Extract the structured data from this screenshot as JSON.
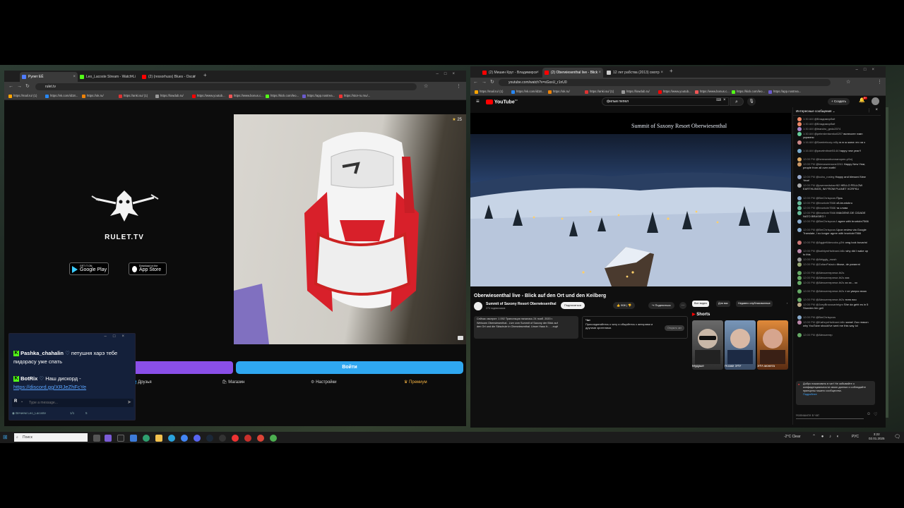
{
  "left_browser": {
    "tabs": [
      {
        "title": "Рулет ЕЁ",
        "color": "#4f7cff",
        "active": true
      },
      {
        "title": "Leo_Lacoste Stream - Watch Li",
        "color": "#53fc18",
        "active": false
      },
      {
        "title": "(2) (ressorhuss) Blues - Oscar",
        "color": "#ff0000",
        "active": false
      }
    ],
    "url": "rulet.tv",
    "bookmarks": [
      {
        "label": "https://mail.ru/ (1)",
        "color": "#ffa400"
      },
      {
        "label": "https://vk.com/id18...",
        "color": "#2787f5"
      },
      {
        "label": "https://ok.ru/",
        "color": "#ee8208"
      },
      {
        "label": "https://anki.su/ (1)",
        "color": "#d33"
      },
      {
        "label": "https://lowdub.ru/",
        "color": "#999"
      },
      {
        "label": "https://www.youtub...",
        "color": "#ff0000"
      },
      {
        "label": "https://www.bonus.c...",
        "color": "#e55"
      },
      {
        "label": "https://kick.com/leo...",
        "color": "#53fc18"
      },
      {
        "label": "https://app.nostrea...",
        "color": "#6a5acd"
      },
      {
        "label": "https://stor-ru.mu/...",
        "color": "#e33"
      }
    ],
    "site": {
      "logo_text": "RULET.TV",
      "google_play_top": "GET IT ON",
      "google_play": "Google Play",
      "app_store_top": "Download on the",
      "app_store": "App Store",
      "viewer_count": "25",
      "join_button": "Войти",
      "nav": [
        {
          "label": "Друзья",
          "icon": "friends-icon"
        },
        {
          "label": "Магазин",
          "icon": "shop-icon"
        },
        {
          "label": "Настройки",
          "icon": "gear-icon"
        },
        {
          "label": "Премиум",
          "icon": "crown-icon"
        }
      ]
    }
  },
  "chat_overlay": {
    "messages": [
      {
        "user": "Pashka_chahalin",
        "text": "петушня харэ тебе пидорасу уже спать"
      },
      {
        "user": "BotRix",
        "text": "Наш дискорд -"
      }
    ],
    "link": "https://discord.gg/XRJeZhFcYe",
    "input_placeholder": "Type a message...",
    "footer_user": "Вечием Leo_Lacoste",
    "footer_stats": "1/1",
    "footer_count": "5"
  },
  "right_browser": {
    "tabs": [
      {
        "title": "(2) Мишин Круг - Владимирск",
        "color": "#ff0000",
        "active": false
      },
      {
        "title": "(2) Oberwiesenthal live - Blick",
        "color": "#ff0000",
        "active": true
      },
      {
        "title": "12 лет рабства (2013) смотр",
        "color": "#cccccc",
        "active": false
      }
    ],
    "url": "youtube.com/watch?v=sGsxU_r1nU0",
    "bookmarks": [
      {
        "label": "https://mail.ru/ (1)",
        "color": "#ffa400"
      },
      {
        "label": "https://vk.com/id18...",
        "color": "#2787f5"
      },
      {
        "label": "https://ok.ru/",
        "color": "#ee8208"
      },
      {
        "label": "https://anki.su/ (1)",
        "color": "#d33"
      },
      {
        "label": "https://lowdub.ru/",
        "color": "#999"
      },
      {
        "label": "https://www.youtub...",
        "color": "#ff0000"
      },
      {
        "label": "https://www.bonus.c...",
        "color": "#e55"
      },
      {
        "label": "https://kick.com/leo...",
        "color": "#53fc18"
      },
      {
        "label": "https://app.nostrea...",
        "color": "#6a5acd"
      }
    ]
  },
  "youtube": {
    "logo": "YouTube",
    "country": "RU",
    "search_value": "фильм пепел",
    "create_button": "Создать",
    "notification_count": "9+",
    "video_overlay_title": "Summit of Saxony Resort Oberwiesenthal",
    "video_title": "Oberwiesenthal live - Blick auf den Ort und den Keilberg",
    "channel_name": "Summit of Saxony Resort Oberwiesenthal",
    "subscribers": "274 подписчиков",
    "subscribe_button": "Подписаться",
    "likes": "908",
    "share_button": "Поделиться",
    "description_line1": "Сейчас смотрят: 1 092  Трансляция началась 24 нояб. 2020 г.",
    "description_line2": "Webcam Oberwiesenthal - Live vom Summit of Saxony der Blick auf",
    "description_line3": "den Ort und die Skischule in Oberwiesenthal. Unser Haus fr...  ...ещё",
    "chat_join_label": "Чат",
    "chat_join_text": "Присоединяйтесь к чату и общайтесь с авторами и другими зрителями.",
    "chat_join_button": "Открыть чат",
    "filter_chips": [
      "Все видео",
      "Для вас",
      "Недавно опубликованные"
    ],
    "shorts_label": "Shorts",
    "shorts": [
      {
        "title": "Мудрые"
      },
      {
        "title": "Позже ЭТУ"
      },
      {
        "title": "ЭТА монета"
      }
    ],
    "chat": {
      "header": "Интересные сообщения",
      "input_placeholder": "Напишите в чат",
      "messages": [
        {
          "time": "1:30 AM",
          "user": "@Владимирбаё",
          "text": "",
          "color": "#e86"
        },
        {
          "time": "1:30 AM",
          "user": "@Владимирбаё",
          "text": "",
          "color": "#e86"
        },
        {
          "time": "1:30 AM",
          "user": "@leandro_gedo2074",
          "text": "",
          "color": "#a8c"
        },
        {
          "time": "1:30 AM",
          "user": "@peterdenisenko6207",
          "text": "включите гимн украины",
          "color": "#6c9"
        },
        {
          "time": "1:16 AM",
          "user": "@Samiretcury-m5y",
          "text": "ю ю ж жопа что за з",
          "color": "#c88"
        },
        {
          "time": "1:16 AM",
          "user": "@pavelmitroiri5144",
          "text": "happy new year!!",
          "color": "#7ac"
        },
        {
          "time": "12:00 PM",
          "user": "@hermannbonnanopen-yl1ej",
          "text": "",
          "color": "#da6"
        },
        {
          "time": "12:00 PM",
          "user": "@kievsweenone2241",
          "text": "Happy New Year, people from all over earth!",
          "color": "#c96"
        },
        {
          "time": "12:00 PM",
          "user": "@cubo_rosteg",
          "text": "Happy and blessed New Year!",
          "color": "#9ac"
        },
        {
          "time": "12:00 PM",
          "user": "@pwemedwlacrf82",
          "text": "HELLO FELLOW EARTHLINGS, IM FROM PLANET XCRFKU",
          "color": "#aaa"
        },
        {
          "time": "12:00 PM",
          "user": "@BmChrispcos",
          "text": "Пусь",
          "color": "#8ac"
        },
        {
          "time": "12:00 PM",
          "user": "@bruntobr7566",
          "text": "хй-bruntobru",
          "color": "#6b9"
        },
        {
          "time": "12:00 PM",
          "user": "@bruntobr7566",
          "text": "та слова",
          "color": "#6b9"
        },
        {
          "time": "12:00 PM",
          "user": "@bruntobr7566",
          "text": "IMAGENS DE CIDADE NATO BRASIEO !",
          "color": "#6b9"
        },
        {
          "time": "12:00 PM",
          "user": "@BmChrispcos",
          "text": "I agree with bruntobr7566",
          "color": "#8ac"
        },
        {
          "time": "12:00 PM",
          "user": "@BmChrispcos",
          "text": "Upon review via Google Translate, I no longer agree with bruntobr7566",
          "color": "#8ac"
        },
        {
          "time": "12:00 PM",
          "user": "@AggieMdmocks-y2hl",
          "text": "omg look bovarini",
          "color": "#c77"
        },
        {
          "time": "12:00 PM",
          "user": "@kathlymHubbard-b8c",
          "text": "why did I wake up to this",
          "color": "#b8a"
        },
        {
          "time": "12:00 PM",
          "user": "@Ahiggly_mush",
          "text": "",
          "color": "#999"
        },
        {
          "time": "12:00 PM",
          "user": "@ZoltanPalacio",
          "text": "tibose, de paranrni",
          "color": "#9a7"
        },
        {
          "time": "12:00 PM",
          "user": "@Alexuerreprese-th2s",
          "text": "",
          "color": "#6a6"
        },
        {
          "time": "12:00 PM",
          "user": "@Alexuerreprese-th2s",
          "text": "ххх",
          "color": "#6a6"
        },
        {
          "time": "12:00 PM",
          "user": "@Alexuerreprese-th2s",
          "text": "хх хх... хх",
          "color": "#6a6"
        },
        {
          "time": "12:00 PM",
          "user": "@Alexuerreprese-th2s",
          "text": "т ят уверсс вхаа",
          "color": "#6a6"
        },
        {
          "time": "12:00 PM",
          "user": "@Alexuerreprese-th2s",
          "text": "тятю вхо",
          "color": "#6a6"
        },
        {
          "time": "12:00 PM",
          "user": "@JoeyBroussartetgm",
          "text": "She da geht es in 5 Stunden hin gell",
          "color": "#ba8"
        },
        {
          "time": "12:00 PM",
          "user": "@BmChrispcos",
          "text": "",
          "color": "#8ac"
        },
        {
          "time": "12:00 PM",
          "user": "@KathrynHubbard-b8c",
          "text": "same! Zoo reason why YouTube should've sent me this way lol",
          "color": "#b8a"
        },
        {
          "time": "12:00 PM",
          "user": "@Alexuerrep",
          "text": "",
          "color": "#6a6"
        }
      ],
      "notice_text": "Добро пожаловать в чат! Не забывайте о конфиденциальности своих данных и соблюдайте принципы нашего сообщества.",
      "notice_link": "Подробнее"
    }
  },
  "taskbar": {
    "search_placeholder": "Поиск",
    "weather": "-2°C  Clear",
    "language": "РУС",
    "time": "3:22",
    "date": "02.01.2025"
  }
}
